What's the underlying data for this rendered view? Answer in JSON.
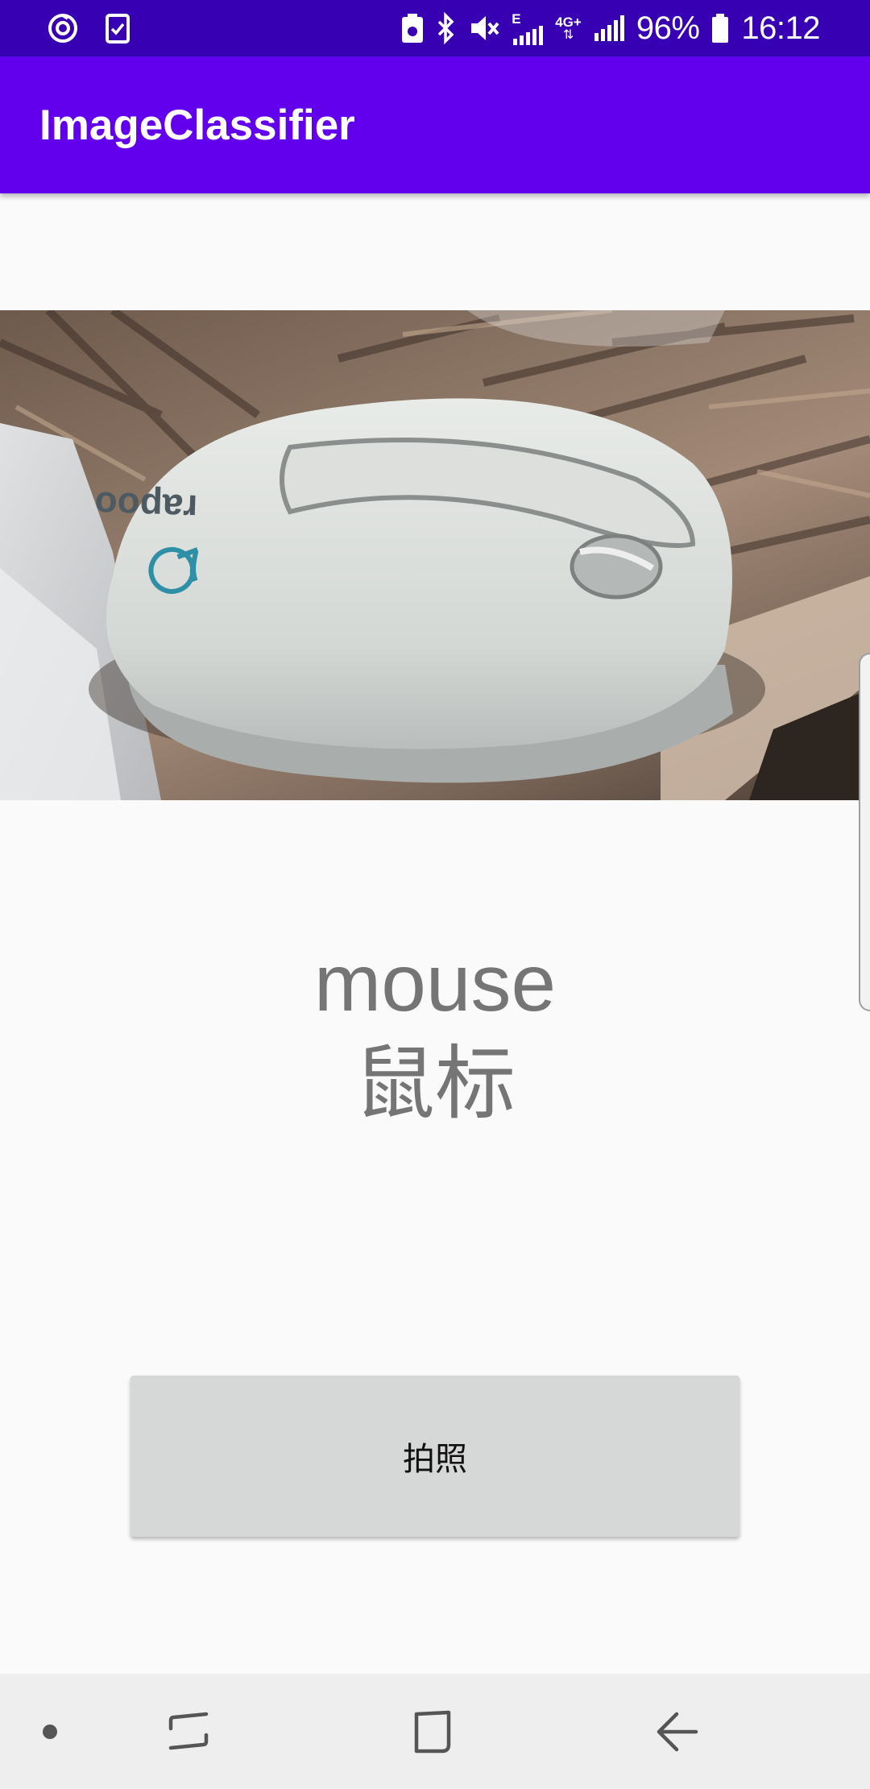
{
  "status_bar": {
    "battery_percent": "96%",
    "time": "16:12",
    "network_small": "E",
    "network_type": "4G+",
    "icons": [
      "sync-icon",
      "task-icon",
      "battery-saver-icon",
      "bluetooth-icon",
      "mute-icon",
      "signal-icon",
      "battery-icon"
    ]
  },
  "app_bar": {
    "title": "ImageClassifier"
  },
  "photo": {
    "subject_print": "rapoo"
  },
  "result": {
    "label_en": "mouse",
    "label_zh": "鼠标"
  },
  "capture_button": {
    "label": "拍照"
  },
  "nav_bar": {
    "icons": [
      "dot-icon",
      "recent-apps-icon",
      "home-icon",
      "back-icon"
    ]
  },
  "colors": {
    "status_bar": "#3700b3",
    "app_bar": "#6200ee",
    "button_bg": "#d6d7d7",
    "result_text": "#757575"
  }
}
